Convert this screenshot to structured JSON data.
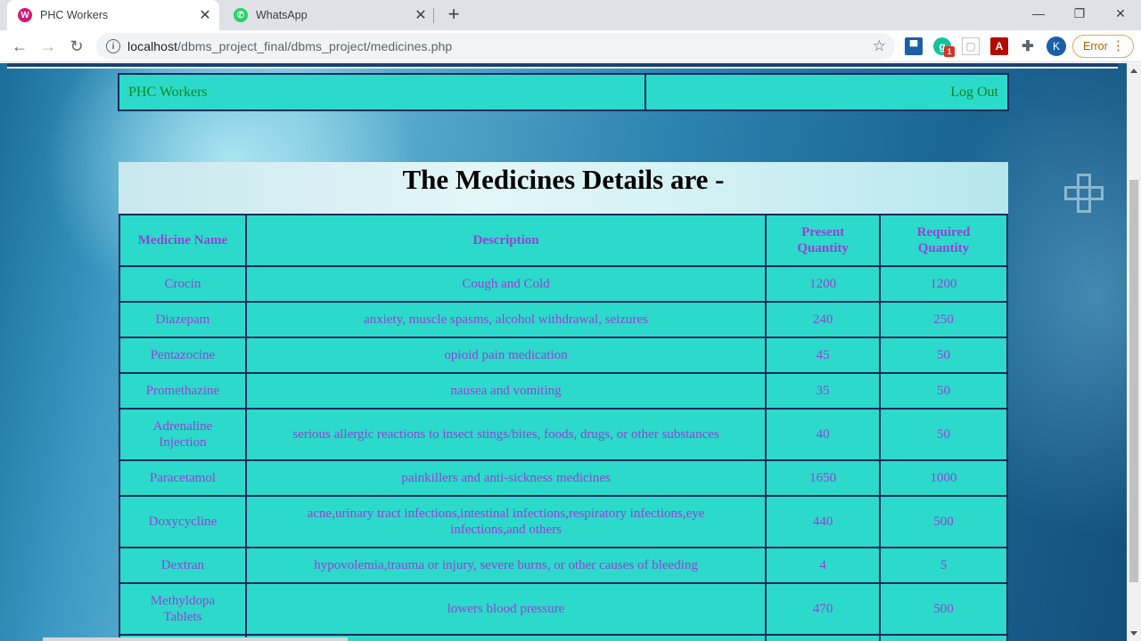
{
  "browser": {
    "tabs": [
      {
        "title": "PHC Workers",
        "icon": "wamp-icon",
        "active": true
      },
      {
        "title": "WhatsApp",
        "icon": "whatsapp-icon",
        "active": false
      }
    ],
    "url_host": "localhost",
    "url_path": "/dbms_project_final/dbms_project/medicines.php",
    "profile_initial": "K",
    "error_label": "Error",
    "extension_badge": "1"
  },
  "nav": {
    "brand": "PHC Workers",
    "logout": "Log Out"
  },
  "page": {
    "heading": "The Medicines Details are -"
  },
  "table": {
    "headers": [
      "Medicine Name",
      "Description",
      "Present Quantity",
      "Required Quantity"
    ],
    "rows": [
      {
        "name": "Crocin",
        "description": "Cough and Cold",
        "present": "1200",
        "required": "1200"
      },
      {
        "name": "Diazepam",
        "description": "anxiety, muscle spasms, alcohol withdrawal, seizures",
        "present": "240",
        "required": "250"
      },
      {
        "name": "Pentazocine",
        "description": "opioid pain medication",
        "present": "45",
        "required": "50"
      },
      {
        "name": "Promethazine",
        "description": "nausea and vomiting",
        "present": "35",
        "required": "50"
      },
      {
        "name": "Adrenaline Injection",
        "description": "serious allergic reactions to insect stings/bites, foods, drugs, or other substances",
        "present": "40",
        "required": "50"
      },
      {
        "name": "Paracetamol",
        "description": "painkillers and anti-sickness medicines",
        "present": "1650",
        "required": "1000"
      },
      {
        "name": "Doxycycline",
        "description": "acne,urinary tract infections,intestinal infections,respiratory infections,eye infections,and others",
        "present": "440",
        "required": "500"
      },
      {
        "name": "Dextran",
        "description": "hypovolemia,trauma or injury, severe burns, or other causes of bleeding",
        "present": "4",
        "required": "5"
      },
      {
        "name": "Methyldopa Tablets",
        "description": "lowers blood pressure",
        "present": "470",
        "required": "500"
      }
    ]
  },
  "colors": {
    "table_bg": "#2bdaca",
    "table_text": "#9b3fd9",
    "nav_text": "#0c8a1f",
    "border": "#1a2a5c"
  }
}
